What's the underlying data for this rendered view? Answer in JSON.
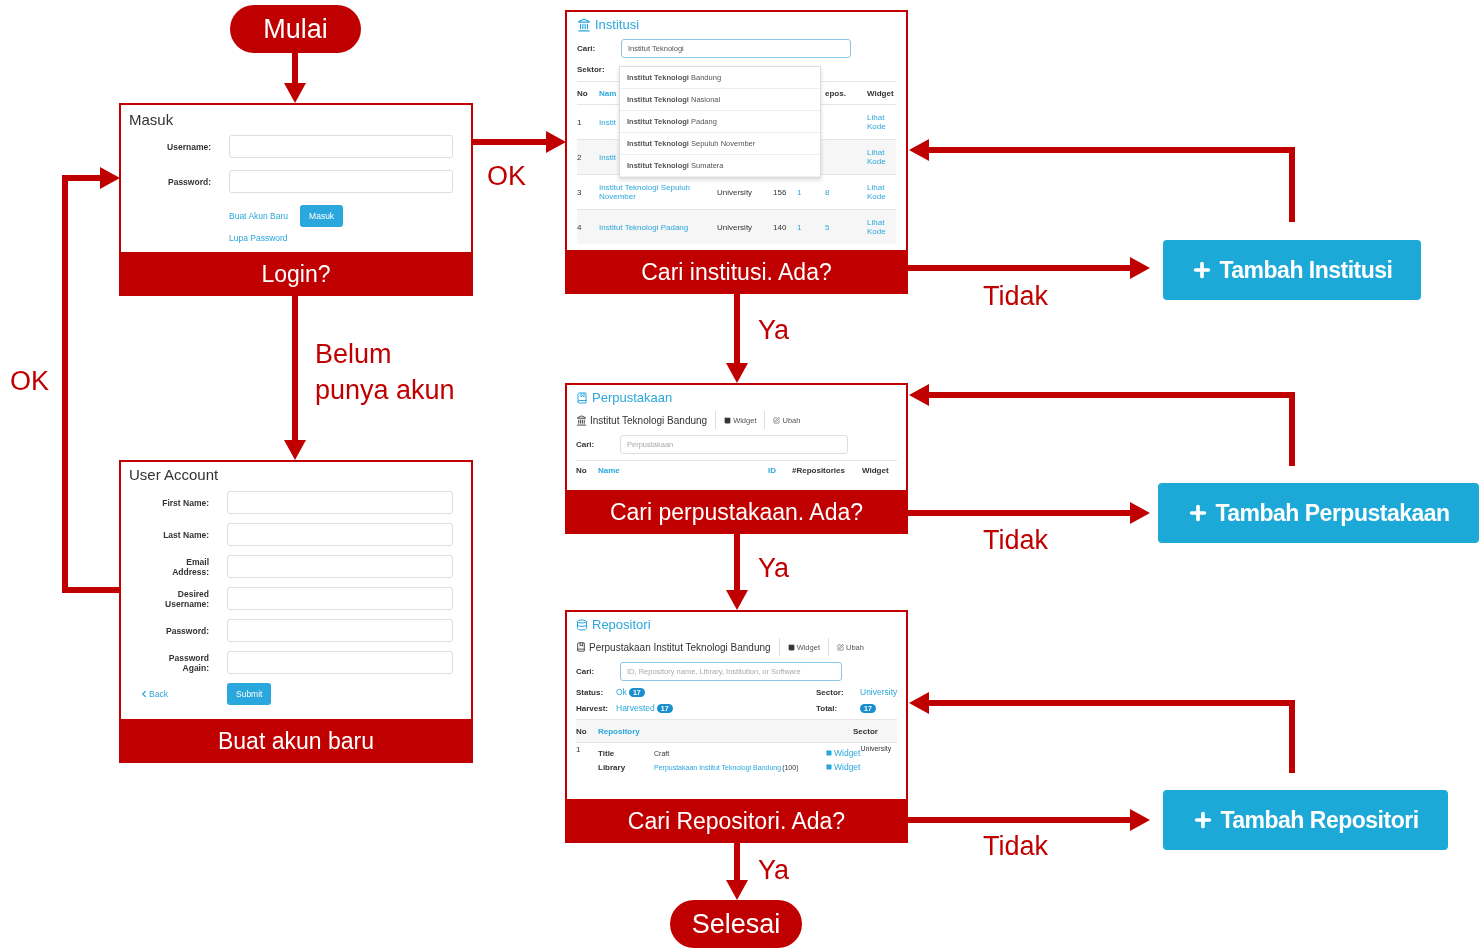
{
  "start": {
    "label": "Mulai"
  },
  "login": {
    "title": "Masuk",
    "fields": [
      {
        "label": "Username:"
      },
      {
        "label": "Password:"
      }
    ],
    "register_link": "Buat Akun Baru",
    "submit": "Masuk",
    "forgot_link": "Lupa Password",
    "caption": "Login?"
  },
  "register": {
    "title": "User Account",
    "fields": [
      {
        "label": "First Name:"
      },
      {
        "label": "Last Name:"
      },
      {
        "label": "Email Address:"
      },
      {
        "label": "Desired Username:"
      },
      {
        "label": "Password:"
      },
      {
        "label": "Password Again:"
      }
    ],
    "back": "Back",
    "submit": "Submit",
    "caption": "Buat akun baru"
  },
  "institution": {
    "title": "Institusi",
    "search_label": "Cari:",
    "search_value": "Institut Teknologi",
    "sector_label": "Sektor:",
    "suggestions": [
      "**Institut Teknologi** Bandung",
      "**Institut Teknologi** Nasional",
      "**Institut Teknologi** Padang",
      "**Institut Teknologi** Sepuluh November",
      "**Institut Teknologi** Sumatera"
    ],
    "columns": [
      "No",
      "Nam",
      "epos.",
      "Widget"
    ],
    "rows": [
      {
        "no": "1",
        "name": "Instit",
        "widget": "Lihat Kode"
      },
      {
        "no": "2",
        "name": "Instit",
        "widget": "Lihat Kode"
      },
      {
        "no": "3",
        "name": "Institut Teknologi Sepuluh November",
        "sector": "University",
        "count": "156",
        "column_5": "1",
        "repos": "8",
        "widget": "Lihat Kode"
      },
      {
        "no": "4",
        "name": "Institut Teknologi Padang",
        "sector": "University",
        "count": "140",
        "column_5": "1",
        "repos": "5",
        "widget": "Lihat Kode"
      }
    ],
    "caption": "Cari institusi. Ada?"
  },
  "library": {
    "title": "Perpustakaan",
    "institution": "Institut Teknologi Bandung",
    "widget": "Widget",
    "edit": "Ubah",
    "search_label": "Cari:",
    "search_placeholder": "Perpustakaan",
    "columns": [
      "No",
      "Name",
      "ID",
      "#Repositories",
      "Widget"
    ],
    "caption": "Cari perpustakaan. Ada?"
  },
  "repository": {
    "title": "Repositori",
    "library": "Perpustakaan Institut Teknologi Bandung",
    "widget": "Widget",
    "edit": "Ubah",
    "search_label": "Cari:",
    "search_placeholder": "ID, Repository name, Library, Institution, or Software",
    "filters": [
      {
        "label": "Status:",
        "value": "Ok",
        "count": "17"
      },
      {
        "label": "Sector:",
        "value": "University"
      },
      {
        "label": "Harvest:",
        "value": "Harvested",
        "count": "17"
      },
      {
        "label": "Total:",
        "count": "17"
      }
    ],
    "columns": [
      "No",
      "Repository",
      "Sector"
    ],
    "rows": [
      {
        "no": "1",
        "sector": "University",
        "lines": [
          {
            "kind": "text",
            "label": "Title",
            "value": "Craft",
            "widget": "Widget"
          },
          {
            "kind": "link",
            "label": "Library",
            "value": "Perpustakaan Institut Teknologi Bandung",
            "count": "(100)",
            "widget": "Widget"
          }
        ]
      }
    ],
    "caption": "Cari Repositori. Ada?"
  },
  "add_buttons": [
    {
      "label": "Tambah Institusi"
    },
    {
      "label": "Tambah Perpustakaan"
    },
    {
      "label": "Tambah Repositori"
    }
  ],
  "edges": [
    {
      "label": "OK"
    },
    {
      "label": "OK"
    },
    {
      "label": "Belum punya akun"
    },
    {
      "label": "Ya"
    },
    {
      "label": "Tidak"
    },
    {
      "label": "Ya"
    },
    {
      "label": "Tidak"
    },
    {
      "label": "Ya"
    },
    {
      "label": "Tidak"
    }
  ],
  "end": {
    "label": "Selesai"
  }
}
